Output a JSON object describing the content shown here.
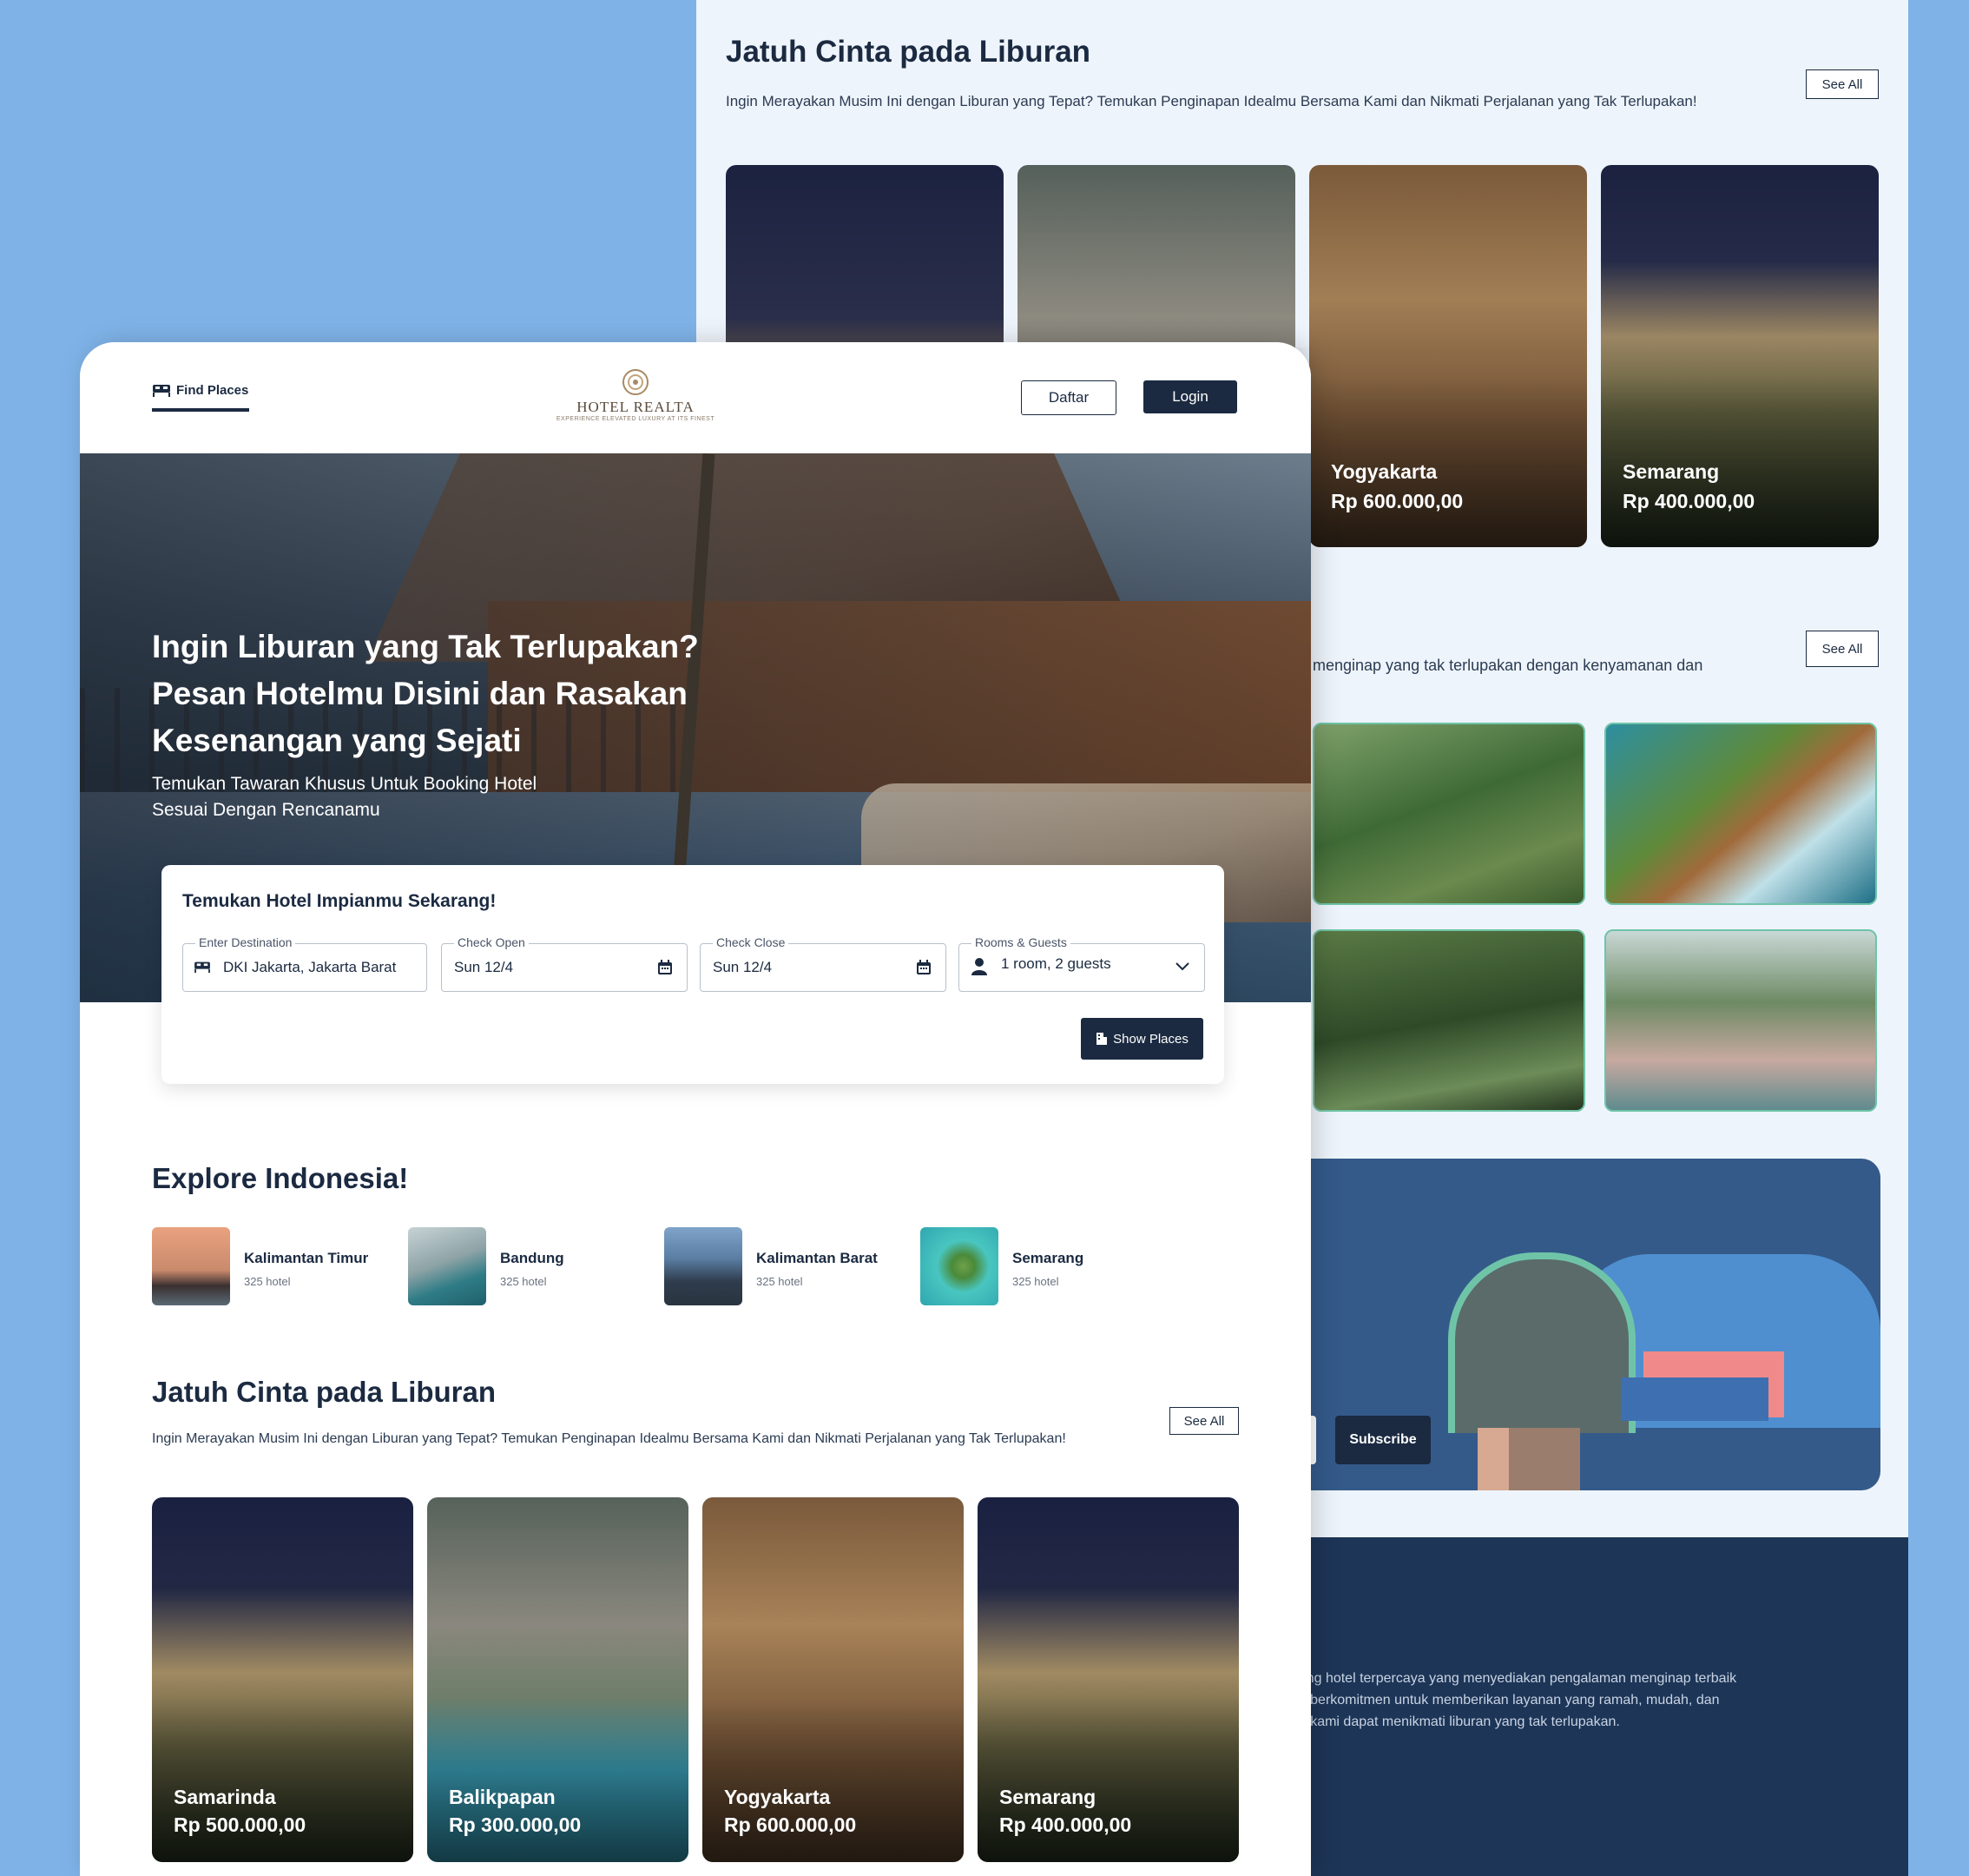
{
  "back": {
    "section_title": "Jatuh Cinta pada Liburan",
    "section_desc": "Ingin Merayakan Musim Ini dengan Liburan yang Tepat? Temukan Penginapan Idealmu Bersama Kami dan Nikmati Perjalanan yang Tak Terlupakan!",
    "see_all_1": "See All",
    "cards": [
      {
        "city": "",
        "price": ""
      },
      {
        "city": "",
        "price": ""
      },
      {
        "city": "Yogyakarta",
        "price": "Rp 600.000,00"
      },
      {
        "city": "Semarang",
        "price": "Rp 400.000,00"
      }
    ],
    "see_all_2": "See All",
    "partial_desc": "menginap yang tak terlupakan dengan kenyamanan dan",
    "subscribe_label": "Subscribe",
    "footer_text": [
      "form booking hotel terpercaya yang menyediakan pengalaman menginap terbaik",
      "baik. Kami berkomitmen untuk memberikan layanan yang ramah, mudah, dan",
      "pelanggan kami dapat menikmati liburan yang tak terlupakan."
    ]
  },
  "nav": {
    "find_places": "Find Places",
    "logo_name": "HOTEL REALTA",
    "logo_tagline": "EXPERIENCE ELEVATED LUXURY AT ITS FINEST",
    "register": "Daftar",
    "login": "Login"
  },
  "hero": {
    "title_lines": [
      "Ingin Liburan yang Tak Terlupakan?",
      "Pesan Hotelmu Disini dan Rasakan",
      "Kesenangan yang Sejati"
    ],
    "subtitle_lines": [
      "Temukan Tawaran Khusus Untuk Booking Hotel",
      "Sesuai Dengan Rencanamu"
    ]
  },
  "search": {
    "heading": "Temukan Hotel Impianmu Sekarang!",
    "destination": {
      "label": "Enter Destination",
      "value": "DKI Jakarta, Jakarta Barat"
    },
    "check_open": {
      "label": "Check Open",
      "value": "Sun 12/4"
    },
    "check_close": {
      "label": "Check Close",
      "value": "Sun 12/4"
    },
    "rooms": {
      "label": "Rooms & Guests",
      "value": "1 room, 2 guests"
    },
    "submit": "Show Places"
  },
  "explore": {
    "title": "Explore Indonesia!",
    "items": [
      {
        "name": "Kalimantan Timur",
        "count": "325 hotel"
      },
      {
        "name": "Bandung",
        "count": "325 hotel"
      },
      {
        "name": "Kalimantan Barat",
        "count": "325 hotel"
      },
      {
        "name": "Semarang",
        "count": "325 hotel"
      }
    ]
  },
  "love": {
    "title": "Jatuh Cinta pada Liburan",
    "desc": "Ingin Merayakan Musim Ini dengan Liburan yang Tepat? Temukan Penginapan Idealmu Bersama Kami dan Nikmati Perjalanan yang Tak Terlupakan!",
    "see_all": "See All",
    "cards": [
      {
        "city": "Samarinda",
        "price": "Rp 500.000,00"
      },
      {
        "city": "Balikpapan",
        "price": "Rp 300.000,00"
      },
      {
        "city": "Yogyakarta",
        "price": "Rp 600.000,00"
      },
      {
        "city": "Semarang",
        "price": "Rp 400.000,00"
      }
    ]
  },
  "colors": {
    "primary_dark": "#1b2a41",
    "outer_bg": "#7fb3e8",
    "panel_bg": "#eef4fb",
    "newsletter_bg": "#345a8a",
    "footer_bg": "#1d3557",
    "accent_green": "#6fc4a8",
    "accent_coral": "#f08a8a"
  }
}
